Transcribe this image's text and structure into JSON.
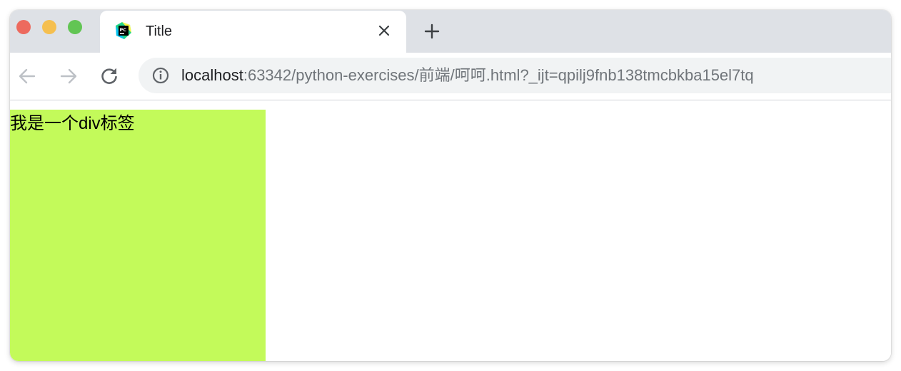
{
  "colors": {
    "traffic_close": "#ed6a5e",
    "traffic_minimize": "#f5bf4f",
    "traffic_maximize": "#62c554",
    "div_background": "#c3fa5a"
  },
  "tab": {
    "favicon": "pycharm-icon",
    "title": "Title",
    "close_icon": "close-icon"
  },
  "toolbar": {
    "new_tab_icon": "plus-icon",
    "back_icon": "arrow-left-icon",
    "forward_icon": "arrow-right-icon",
    "reload_icon": "reload-icon",
    "site_info_icon": "info-icon"
  },
  "address": {
    "host": "localhost",
    "rest": ":63342/python-exercises/前端/呵呵.html?_ijt=qpilj9fnb138tmcbkba15el7tq"
  },
  "page": {
    "div_text": "我是一个div标签"
  }
}
